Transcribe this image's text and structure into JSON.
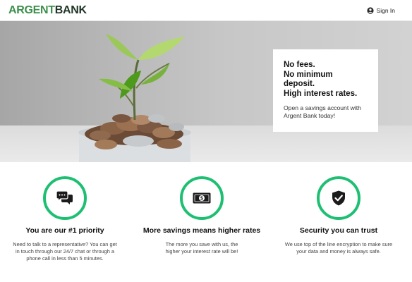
{
  "brand": {
    "name_part1": "ARGENT",
    "name_part2": "BANK",
    "primary_color": "#3b8f4a",
    "accent_color": "#1fbf73"
  },
  "header": {
    "signin_label": "Sign In",
    "signin_icon": "user-circle-icon"
  },
  "hero": {
    "headline": [
      "No fees.",
      "No minimum",
      "deposit.",
      "High interest rates."
    ],
    "body": "Open a savings account with Argent Bank today!"
  },
  "features": [
    {
      "icon": "chat-bubbles-icon",
      "title": "You are our #1 priority",
      "text": "Need to talk to a representative? You can get in touch through our 24/7 chat or through a phone call in less than 5 minutes."
    },
    {
      "icon": "money-bill-icon",
      "title": "More savings means higher rates",
      "text": "The more you save with us, the higher your interest rate will be!"
    },
    {
      "icon": "shield-check-icon",
      "title": "Security you can trust",
      "text": "We use top of the line encryption to make sure your data and money is always safe."
    }
  ]
}
